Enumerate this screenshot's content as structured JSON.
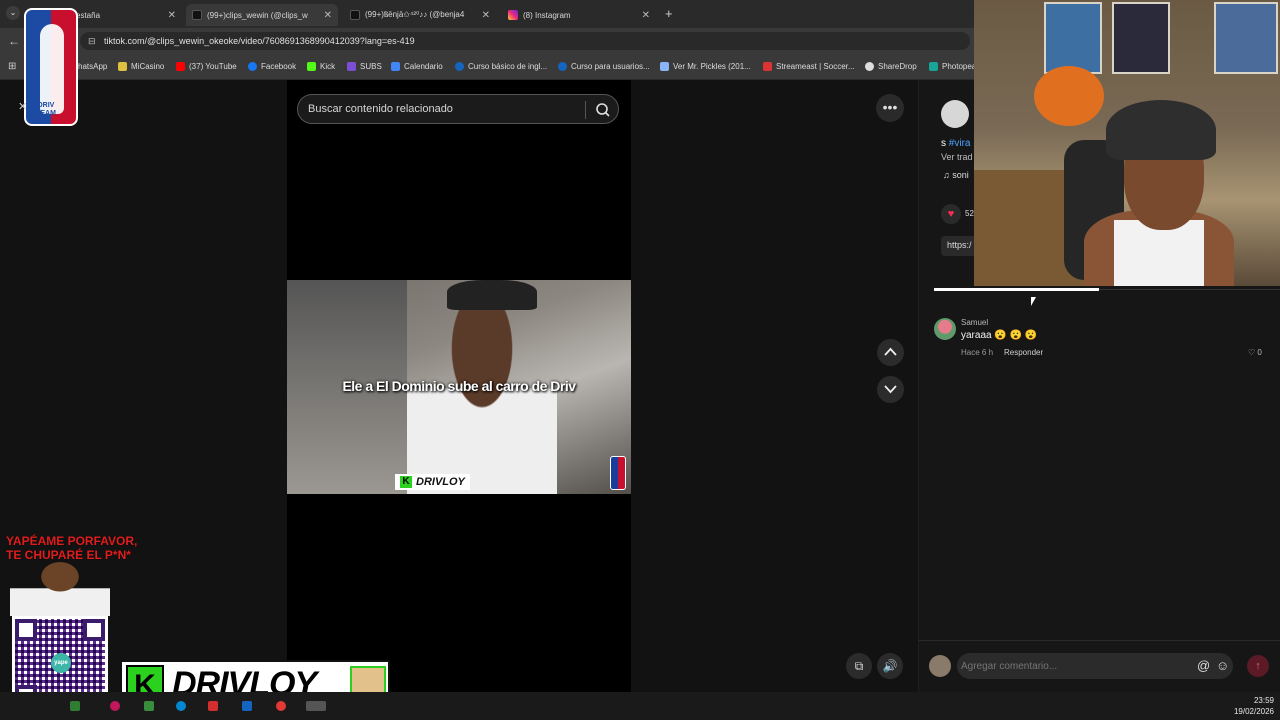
{
  "browser": {
    "tabs": [
      {
        "title": "estaña",
        "icon": "generic-tab-icon"
      },
      {
        "title": "(99+)clips_wewin (@clips_w",
        "icon": "tiktok-icon"
      },
      {
        "title": "(99+)Ⲃēnjā✩⁴²⁰♪♪ (@benja4",
        "icon": "tiktok-icon"
      },
      {
        "title": "(8) Instagram",
        "icon": "instagram-icon"
      }
    ],
    "new_tab": "+",
    "url": "tiktok.com/@clips_wewin_okeoke/video/7608691368990412039?lang=es-419",
    "bookmarks": [
      {
        "label": "hatsApp",
        "color": "#25d366"
      },
      {
        "label": "MiCasino",
        "color": "#e0c040"
      },
      {
        "label": "(37) YouTube",
        "color": "#ff0000"
      },
      {
        "label": "Facebook",
        "color": "#1877f2"
      },
      {
        "label": "Kick",
        "color": "#53fc18"
      },
      {
        "label": "SUBS",
        "color": "#7a4fd6"
      },
      {
        "label": "Calendario",
        "color": "#4285f4"
      },
      {
        "label": "Curso básico de ingl...",
        "color": "#1565c0"
      },
      {
        "label": "Curso para usuarios...",
        "color": "#1565c0"
      },
      {
        "label": "Ver Mr. Pickles (201...",
        "color": "#8ab4f8"
      },
      {
        "label": "Streameast | Soccer...",
        "color": "#d33"
      },
      {
        "label": "ShareDrop",
        "color": "#ddd"
      },
      {
        "label": "Photopea",
        "color": "#18a497"
      }
    ]
  },
  "tiktok": {
    "search_placeholder": "Buscar contenido relacionado",
    "more_label": "•••",
    "video_caption": "Ele a El Dominio sube al carro de Driv",
    "video_tag": "DRIVLOY",
    "video_tag_k": "K",
    "description_prefix": "s",
    "description_hashtag": "#vira",
    "translate_label": "Ver trad",
    "sound_label": "♫  soni",
    "like_count": "52",
    "link_text": "https:/",
    "comments": [
      {
        "user": "Samuel",
        "text": "yaraaa 😮 😮 😮",
        "time": "Hace 6 h",
        "reply": "Responder",
        "likes": "♡ 0"
      }
    ],
    "comment_placeholder": "Agregar comentario...",
    "at_symbol": "@",
    "emoji_symbol": "☺",
    "send_symbol": "↑"
  },
  "overlays": {
    "logo_text": "DRIV TEAM",
    "yape_line1": "YAPÉAME PORFAVOR,",
    "yape_line2": "TE CHUPARÉ  EL P*N*",
    "qr_logo": "yape",
    "brand_k": "K",
    "brand_name": "DRIVLOY"
  },
  "taskbar": {
    "time": "23:59",
    "date": "19/02/2026"
  }
}
